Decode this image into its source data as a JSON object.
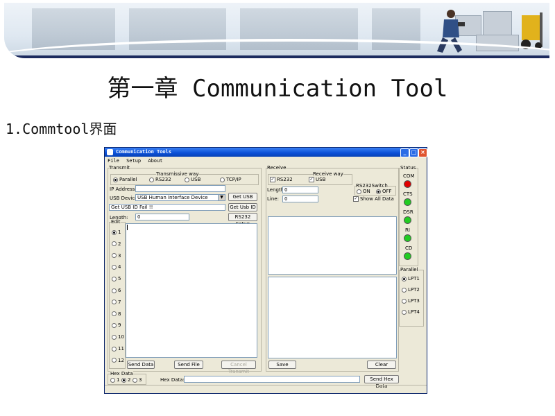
{
  "title": "第一章 Communication Tool",
  "subtitle": "1.Commtool界面",
  "window": {
    "title": "Communication Tools",
    "menu": [
      "File",
      "Setup",
      "About"
    ]
  },
  "transmit": {
    "group_label": "Transmit",
    "way_label": "Transmissive way",
    "ways": [
      {
        "label": "Parallel",
        "selected": true
      },
      {
        "label": "RS232",
        "selected": false
      },
      {
        "label": "USB",
        "selected": false
      },
      {
        "label": "TCP/IP",
        "selected": false
      }
    ],
    "ip_label": "IP Address:",
    "ip_value": "",
    "usb_label": "USB Device:",
    "usb_value": "USB Human Interface Device",
    "get_usb": "Get USB",
    "status_value": "Get USB ID Fail !!",
    "get_usb_id": "Get Usb ID",
    "length_label": "Length:",
    "length_value": "0",
    "rs232_setup": "RS232 Setup",
    "edit_label": "Edit",
    "edit_items": [
      {
        "label": "1",
        "selected": true
      },
      {
        "label": "2",
        "selected": false
      },
      {
        "label": "3",
        "selected": false
      },
      {
        "label": "4",
        "selected": false
      },
      {
        "label": "5",
        "selected": false
      },
      {
        "label": "6",
        "selected": false
      },
      {
        "label": "7",
        "selected": false
      },
      {
        "label": "8",
        "selected": false
      },
      {
        "label": "9",
        "selected": false
      },
      {
        "label": "10",
        "selected": false
      },
      {
        "label": "11",
        "selected": false
      },
      {
        "label": "12",
        "selected": false
      }
    ],
    "send_data": "Send Data",
    "send_file": "Send File",
    "cancel_transmit": "Cancel Transmit"
  },
  "receive": {
    "group_label": "Receive",
    "way_label": "Receive way",
    "rs232": "RS232",
    "usb": "USB",
    "length_label": "Length:",
    "length_value": "0",
    "line_label": "Line:",
    "line_value": "0",
    "switch_label": "RS232Switch",
    "on": "ON",
    "off": "OFF",
    "show_all": "Show All Data",
    "save": "Save",
    "clear": "Clear"
  },
  "status": {
    "group_label": "Status",
    "leds": [
      {
        "label": "COM",
        "color": "#e00000"
      },
      {
        "label": "CTS",
        "color": "#22cc22"
      },
      {
        "label": "DSR",
        "color": "#22cc22"
      },
      {
        "label": "RI",
        "color": "#22cc22"
      },
      {
        "label": "CD",
        "color": "#22cc22"
      }
    ]
  },
  "parallel": {
    "group_label": "Parallel",
    "ports": [
      {
        "label": "LPT1",
        "selected": true
      },
      {
        "label": "LPT2",
        "selected": false
      },
      {
        "label": "LPT3",
        "selected": false
      },
      {
        "label": "LPT4",
        "selected": false
      }
    ]
  },
  "hex": {
    "group_label": "Hex Data",
    "options": [
      {
        "label": "1",
        "selected": false
      },
      {
        "label": "2",
        "selected": true
      },
      {
        "label": "3",
        "selected": false
      }
    ],
    "field_label": "Hex Data:",
    "field_value": "",
    "send": "Send Hex Data"
  }
}
